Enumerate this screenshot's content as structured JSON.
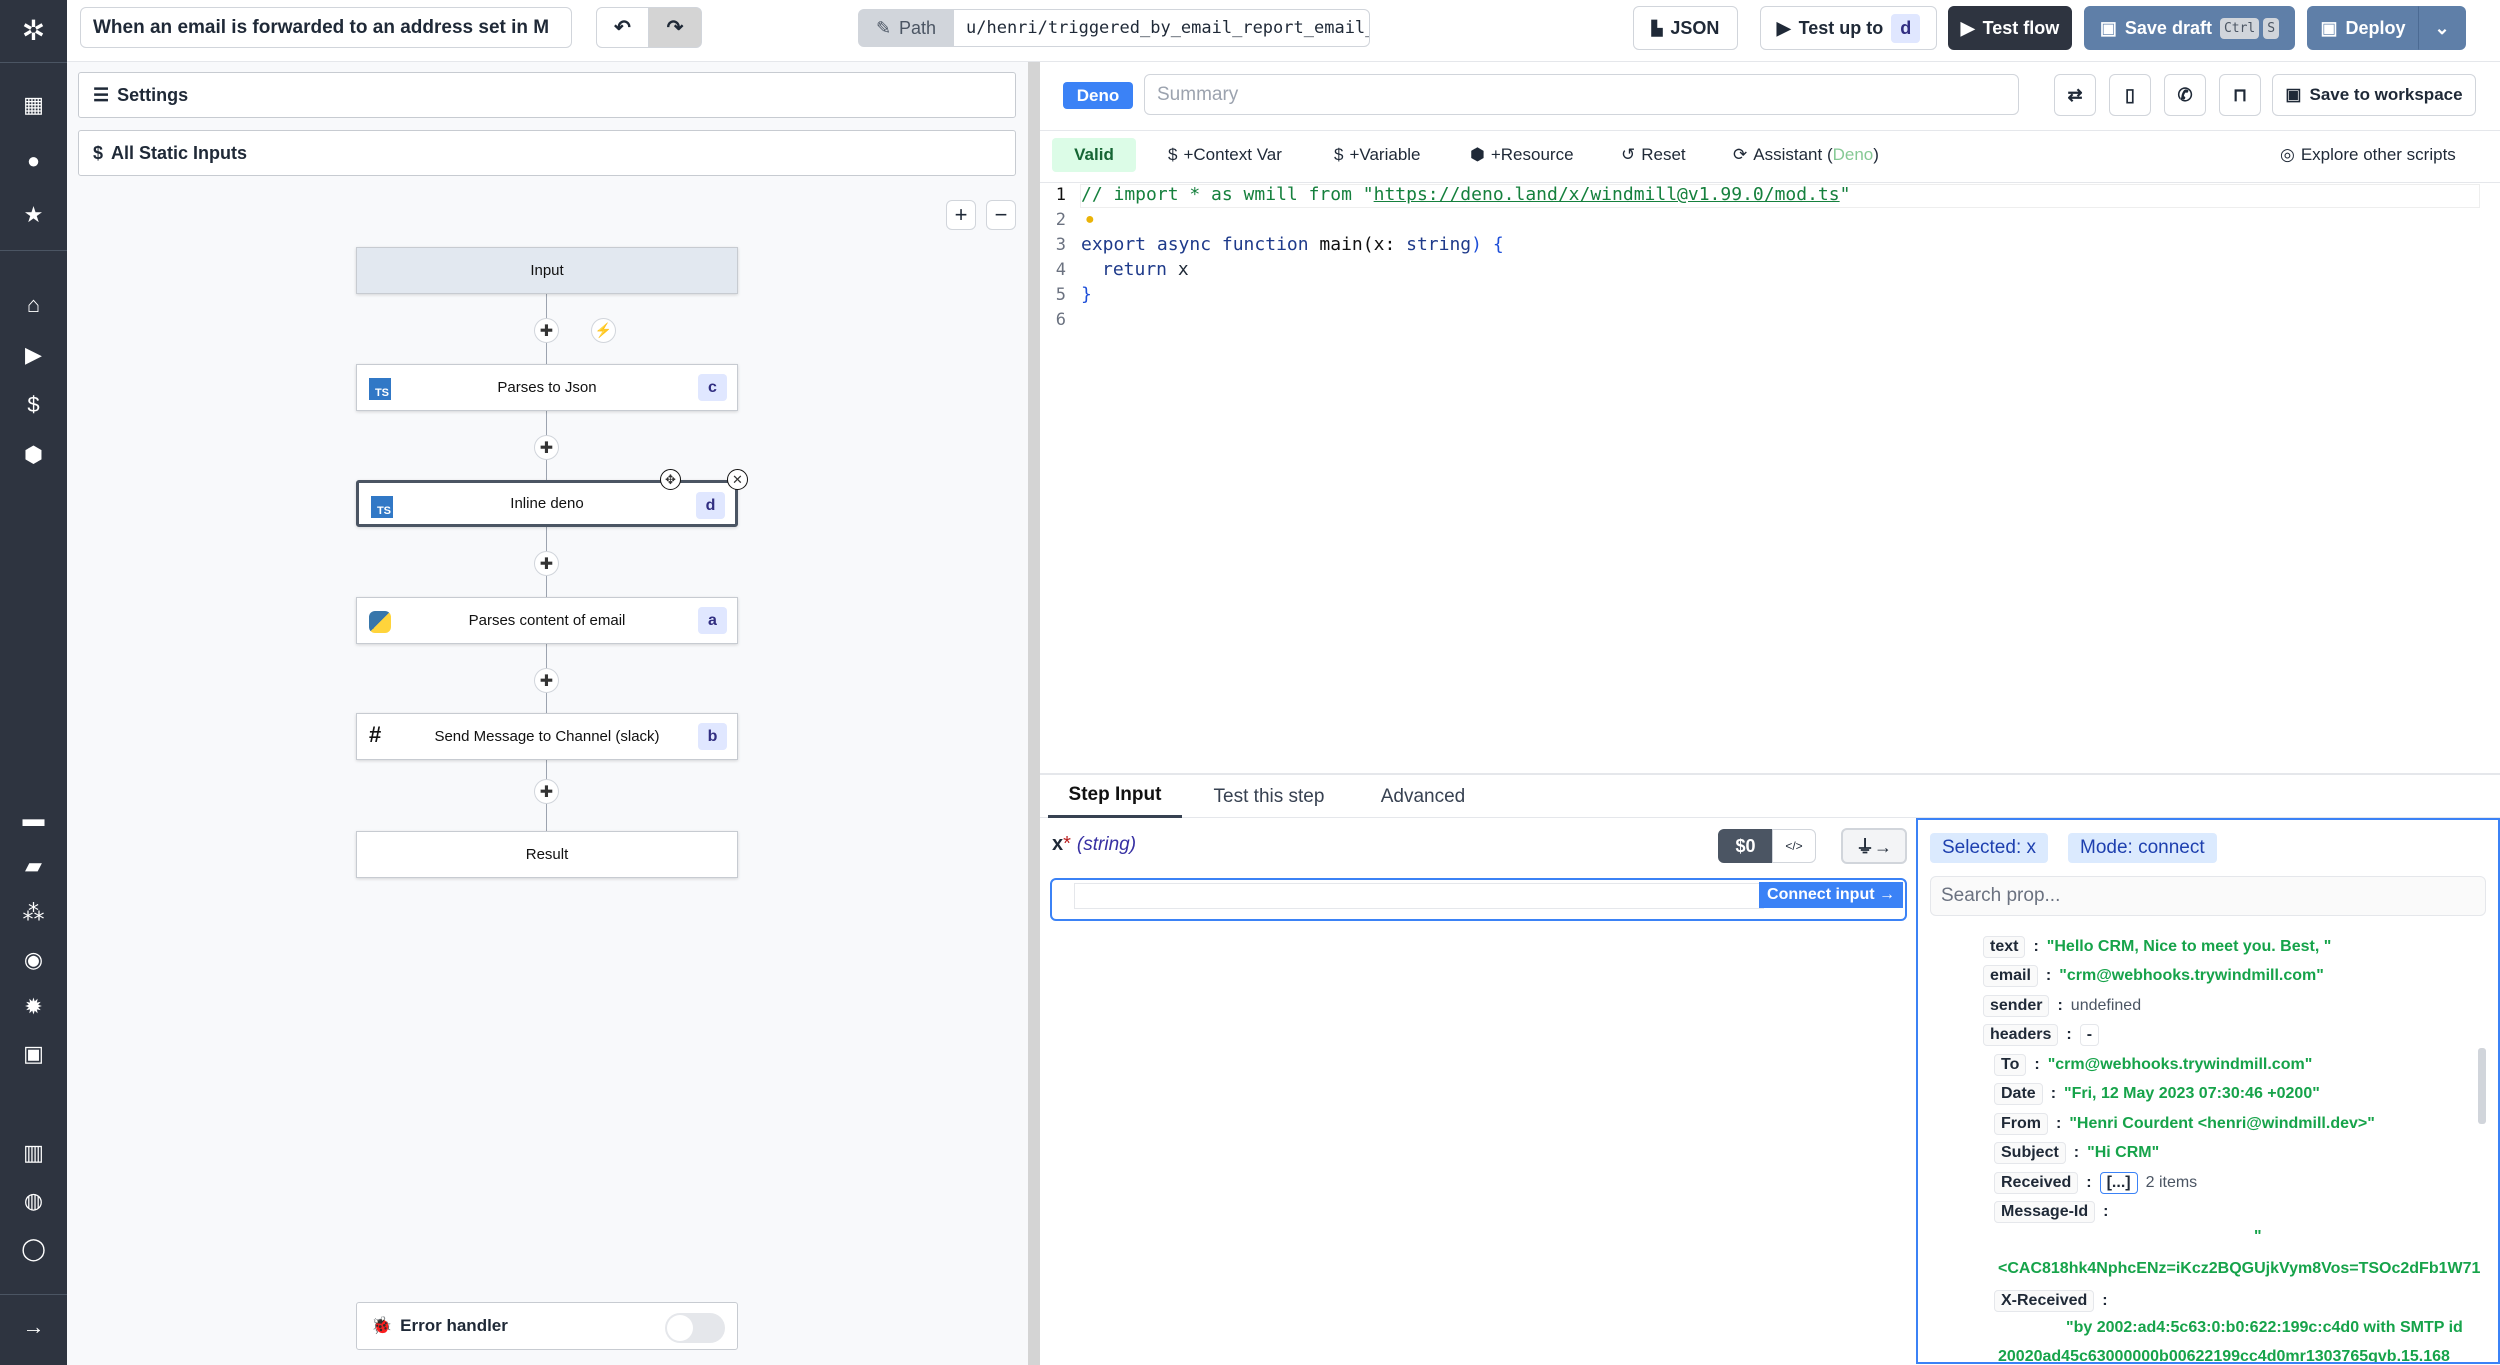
{
  "header": {
    "flow_title": "When an email is forwarded to an address set in M",
    "path_label": "Path",
    "path_value": "u/henri/triggered_by_email_report_email_",
    "json_label": "JSON",
    "test_up_to_label": "Test up to",
    "test_up_to_step": "d",
    "test_flow_label": "Test flow",
    "save_draft_label": "Save draft",
    "shortcut_ctrl": "Ctrl",
    "shortcut_key": "S",
    "deploy_label": "Deploy"
  },
  "left": {
    "settings_label": "Settings",
    "static_inputs_label": "All Static Inputs",
    "error_handler_label": "Error handler",
    "error_handler_enabled": false
  },
  "flow": {
    "input_label": "Input",
    "result_label": "Result",
    "nodes": [
      {
        "label": "Parses to Json",
        "id": "c",
        "lang": "ts",
        "lang_icon": "TS"
      },
      {
        "label": "Inline deno",
        "id": "d",
        "lang": "ts",
        "lang_icon": "TS",
        "selected": true
      },
      {
        "label": "Parses content of email",
        "id": "a",
        "lang": "python"
      },
      {
        "label": "Send Message to Channel (slack)",
        "id": "b",
        "lang": "slack"
      }
    ]
  },
  "editor": {
    "lang_badge": "Deno",
    "summary_placeholder": "Summary",
    "save_workspace_label": "Save to workspace",
    "valid_label": "Valid",
    "context_var_label": "+Context Var",
    "variable_label": "+Variable",
    "resource_label": "+Resource",
    "reset_label": "Reset",
    "assistant_label": "Assistant (",
    "assistant_lang": "Deno",
    "assistant_close": ")",
    "explore_label": "Explore other scripts",
    "lines": {
      "l1_comment": "// import * as wmill from \"",
      "l1_url": "https://deno.land/x/windmill@v1.99.0/mod.ts",
      "l1_end": "\"",
      "l3_kw": "export async function ",
      "l3_fn": "main(x: ",
      "l3_type": "string",
      "l3_end": ") {",
      "l4_kw": "return ",
      "l4_var": "x",
      "l5": "}"
    },
    "line_numbers": [
      "1",
      "2",
      "3",
      "4",
      "5",
      "6"
    ]
  },
  "step": {
    "tabs": [
      "Step Input",
      "Test this step",
      "Advanced"
    ],
    "active_tab": "Step Input",
    "arg_name": "x",
    "required": "*",
    "arg_type": "(string)",
    "mode_js": "$0",
    "connect_label": "Connect input →"
  },
  "props": {
    "selected": "Selected: x",
    "mode": "Mode: connect",
    "search_placeholder": "Search prop...",
    "rows": [
      {
        "key": "text",
        "value": "\"Hello CRM, Nice to meet you. Best, \""
      },
      {
        "key": "email",
        "value": "\"crm@webhooks.trywindmill.com\""
      },
      {
        "key": "sender",
        "value": "undefined"
      },
      {
        "key": "headers",
        "value": "-"
      },
      {
        "key": "To",
        "value": "\"crm@webhooks.trywindmill.com\""
      },
      {
        "key": "Date",
        "value": "\"Fri, 12 May 2023 07:30:46 +0200\""
      },
      {
        "key": "From",
        "value": "\"Henri Courdent <henri@windmill.dev>\""
      },
      {
        "key": "Subject",
        "value": "\"Hi CRM\""
      },
      {
        "key": "Received",
        "value": "[...]",
        "extra": "2 items"
      },
      {
        "key": "Message-Id",
        "value": "\"",
        "cont": "<CAC818hk4NphcENz=iKcz2BQGUjkVym8Vos=TSOc2dFb1W71"
      },
      {
        "key": "X-Received",
        "value": "\"by 2002:ad4:5c63:0:b0:622:199c:c4d0 with SMTP id",
        "cont": "20020ad45c63000000b00622199cc4d0mr1303765qvb.15.168"
      }
    ]
  },
  "colors": {
    "sidebar": "#2e3440",
    "accent": "#3b82f6",
    "deploy": "#5f7fa8",
    "string": "#16a34a"
  }
}
